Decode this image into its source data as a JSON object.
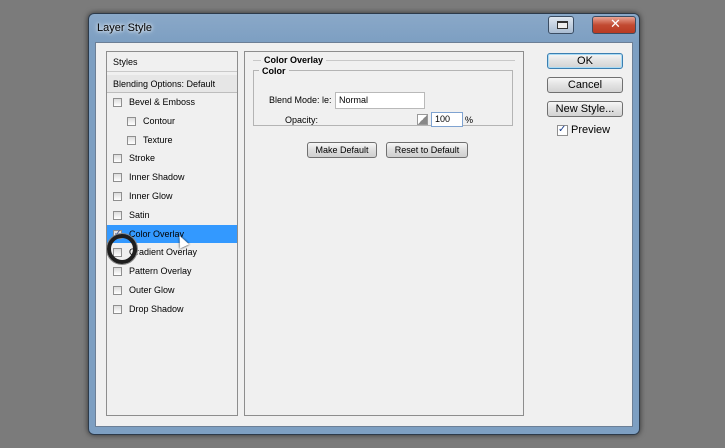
{
  "window": {
    "title": "Layer Style"
  },
  "styles_panel": {
    "header": "Styles",
    "blending_options": "Blending Options: Default",
    "items": [
      {
        "label": "Bevel & Emboss",
        "checked": false,
        "indent": false
      },
      {
        "label": "Contour",
        "checked": false,
        "indent": true
      },
      {
        "label": "Texture",
        "checked": false,
        "indent": true
      },
      {
        "label": "Stroke",
        "checked": false,
        "indent": false
      },
      {
        "label": "Inner Shadow",
        "checked": false,
        "indent": false
      },
      {
        "label": "Inner Glow",
        "checked": false,
        "indent": false
      },
      {
        "label": "Satin",
        "checked": false,
        "indent": false
      },
      {
        "label": "Color Overlay",
        "checked": true,
        "indent": false,
        "selected": true
      },
      {
        "label": "Gradient Overlay",
        "checked": false,
        "indent": false
      },
      {
        "label": "Pattern Overlay",
        "checked": false,
        "indent": false
      },
      {
        "label": "Outer Glow",
        "checked": false,
        "indent": false
      },
      {
        "label": "Drop Shadow",
        "checked": false,
        "indent": false
      }
    ]
  },
  "main": {
    "group_title": "Color Overlay",
    "color_title": "Color",
    "blend_mode_label": "Blend Mode: le:",
    "blend_mode_value": "Normal",
    "opacity_label": "Opacity:",
    "opacity_value": "100",
    "opacity_unit": "%",
    "make_default": "Make Default",
    "reset_default": "Reset to Default"
  },
  "right": {
    "ok": "OK",
    "cancel": "Cancel",
    "new_style": "New Style...",
    "preview": "Preview",
    "preview_checked": true
  },
  "colors": {
    "selection": "#3399ff",
    "title_bar": "#7d9fc2",
    "close_button": "#c24a32"
  }
}
